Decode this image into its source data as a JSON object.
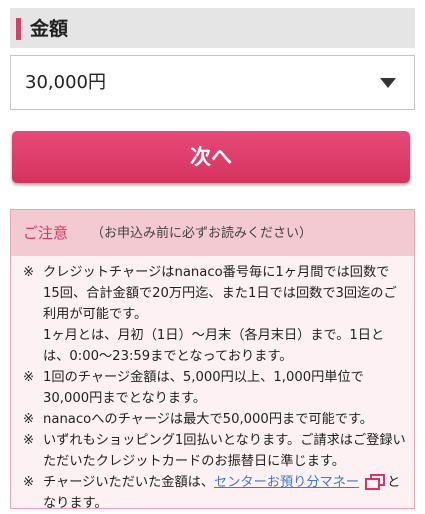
{
  "amount_section": {
    "title": "金額"
  },
  "amount_select": {
    "selected": "30,000円"
  },
  "next_button": {
    "label": "次へ"
  },
  "notice": {
    "title": "ご注意",
    "subtitle": "（お申込み前に必ずお読みください）",
    "mark": "※",
    "items": [
      {
        "text": "クレジットチャージはnanaco番号毎に1ヶ月間では回数で15回、合計金額で20万円迄、また1日では回数で3回迄のご利用が可能です。",
        "subtext": "1ヶ月とは、月初（1日）～月末（各月末日）まで。1日とは、0:00～23:59までとなっております。"
      },
      {
        "text": "1回のチャージ金額は、5,000円以上、1,000円単位で30,000円までとなります。"
      },
      {
        "text": "nanacoへのチャージは最大で50,000円まで可能です。"
      },
      {
        "text": "いずれもショッピング1回払いとなります。ご請求はご登録いただいたクレジットカードのお振替日に準じます。"
      },
      {
        "text_before": "チャージいただいた金額は、",
        "link": "センターお預り分マネー",
        "text_after": "となります。"
      }
    ]
  }
}
